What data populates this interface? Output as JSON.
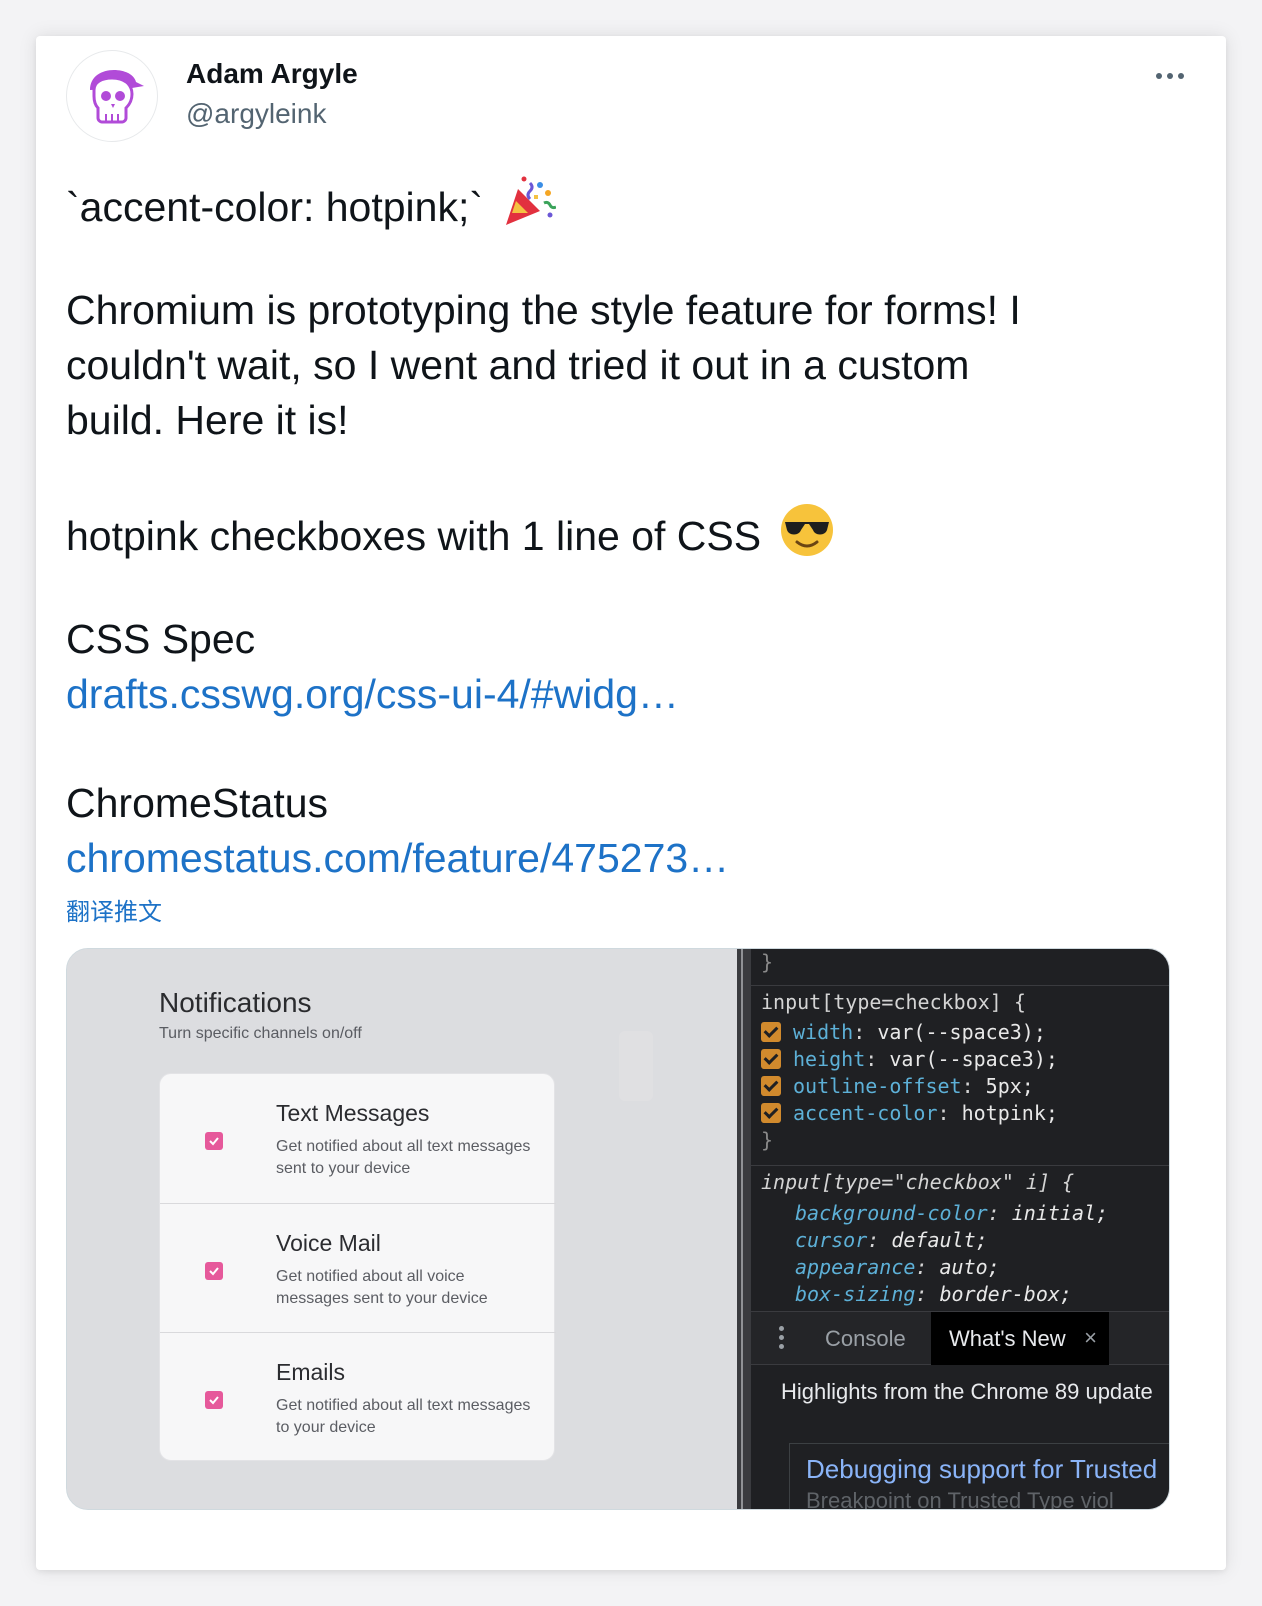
{
  "tweet": {
    "author_name": "Adam Argyle",
    "author_handle": "@argyleink",
    "avatar_icon": "skull-cap-avatar-icon",
    "more_icon": "more-dots-icon",
    "line1": "`accent-color: hotpink;`",
    "line1_emoji": "party-popper-icon",
    "para1_line1": "Chromium is prototyping the style feature for forms! I",
    "para1_line2": "couldn't wait, so I went and tried it out in a custom",
    "para1_line3": "build. Here it is!",
    "line_css": "hotpink checkboxes with 1 line of CSS",
    "line_css_emoji": "sunglasses-face-icon",
    "spec_label": "CSS Spec",
    "spec_link": "drafts.csswg.org/css-ui-4/#widg…",
    "status_label": "ChromeStatus",
    "status_link": "chromestatus.com/feature/475273…",
    "translate": "翻译推文"
  },
  "media": {
    "notifications": {
      "title": "Notifications",
      "subtitle": "Turn specific channels on/off",
      "items": [
        {
          "title": "Text Messages",
          "desc": "Get notified about all text messages sent to your device",
          "checked": true
        },
        {
          "title": "Voice Mail",
          "desc": "Get notified about all voice messages sent to your device",
          "checked": true
        },
        {
          "title": "Emails",
          "desc": "Get notified about all text messages to your device",
          "checked": true
        }
      ],
      "accent": "#e6599b"
    },
    "devtools": {
      "closing_brace": "}",
      "rule1_selector": "input[type=checkbox] {",
      "rule1_props": [
        {
          "name": "width",
          "value": "var(--space3);"
        },
        {
          "name": "height",
          "value": "var(--space3);"
        },
        {
          "name": "outline-offset",
          "value": "5px;"
        },
        {
          "name": "accent-color",
          "value": "hotpink;"
        }
      ],
      "rule2_selector": "input[type=\"checkbox\" i] {",
      "rule2_props": [
        {
          "name": "background-color",
          "value": "initial;"
        },
        {
          "name": "cursor",
          "value": "default;"
        },
        {
          "name": "appearance",
          "value": "auto;"
        },
        {
          "name": "box-sizing",
          "value": "border-box;"
        }
      ],
      "tab_console": "Console",
      "tab_whats_new": "What's New",
      "tab_close": "×",
      "highlights": "Highlights from the Chrome 89 update",
      "card_title": "Debugging support for Trusted",
      "card_sub": "Breakpoint on Trusted Type viol"
    }
  },
  "colors": {
    "link": "#1d72c7",
    "text": "#0f1419",
    "secondary": "#536471",
    "hotpink": "#e6599b",
    "devtools_bg": "#1f2023",
    "prop": "#5db0d7"
  }
}
